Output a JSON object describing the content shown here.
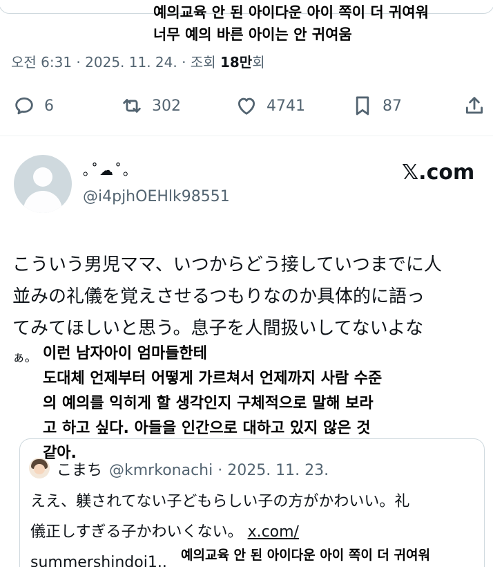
{
  "top_overlay": {
    "line1": "예의교육 안 된 아이다운 아이 쪽이 더 귀여워",
    "line2": "너무 예의 바른 아이는 안 귀여움"
  },
  "meta": {
    "time_date": "오전 6:31 · 2025. 11. 24. · 조회 ",
    "views": "18만",
    "views_suffix": "회"
  },
  "actions": {
    "replies": "6",
    "reposts": "302",
    "likes": "4741",
    "bookmarks": "87"
  },
  "reply_tweet": {
    "display_name": "｡˚☁︎˚｡",
    "handle": "@i4pjhOEHlk98551",
    "brand": "𝕏.com",
    "jp_lines": [
      "こういう男児ママ、いつからどう接していつまでに人",
      "並みの礼儀を覚えさせるつもりなのか具体的に語っ",
      "てみてほしいと思う。息子を人間扱いしてないよな",
      "ぁ。"
    ],
    "ko_lines": [
      "이런 남자아이 엄마들한테",
      "도대체 언제부터 어떻게 가르쳐서 언제까지 사람 수준",
      "의 예의를 익히게 할 생각인지 구체적으로 말해 보라",
      "고 하고 싶다. 아들을 인간으로 대하고 있지 않은 것",
      "같아."
    ]
  },
  "quoted_tweet": {
    "name": "こまち",
    "handle_date": "@kmrkonachi · 2025. 11. 23.",
    "line1": "ええ、躾されてない子どもらしい子の方がかわいい。礼",
    "line2": "儀正しすぎる子かわいくない。",
    "link1": "x.com/",
    "link2": "summershindoi1..",
    "overlay": "예의교육 안 된 아이다운 아이 쪽이 더 귀여워"
  }
}
